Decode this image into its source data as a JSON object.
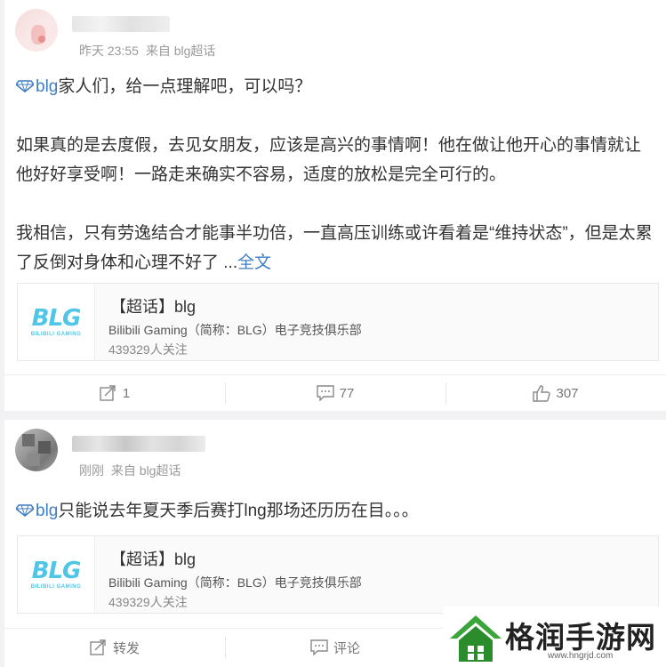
{
  "post1": {
    "meta_time": "昨天 23:55",
    "meta_source": "来自 blg超话",
    "topic_tag": "blg",
    "lead": "家人们，给一点理解吧，可以吗？",
    "para1": "如果真的是去度假，去见女朋友，应该是高兴的事情啊！他在做让他开心的事情就让他好好享受啊！一路走来确实不容易，适度的放松是完全可行的。",
    "para2": "我相信，只有劳逸结合才能事半功倍，一直高压训练或许看着是“维持状态”，但是太累了反倒对身体和心理不好了 ",
    "ellipsis": "...",
    "more": "全文",
    "topic_card": {
      "title": "【超话】blg",
      "desc": "Bilibili Gaming（简称：BLG）电子竞技俱乐部",
      "followers": "439329人关注",
      "logo_big": "BLG",
      "logo_small": "BILIBILI GAMING"
    },
    "actions": {
      "repost": "1",
      "comment": "77",
      "like": "307"
    }
  },
  "post2": {
    "meta_time": "刚刚",
    "meta_source": "来自 blg超话",
    "topic_tag": "blg",
    "text": "只能说去年夏天季后赛打lng那场还历历在目。。。",
    "topic_card": {
      "title": "【超话】blg",
      "desc": "Bilibili Gaming（简称：BLG）电子竞技俱乐部",
      "followers": "439329人关注",
      "logo_big": "BLG",
      "logo_small": "BILIBILI GAMING"
    },
    "actions": {
      "repost": "转发",
      "comment": "评论"
    }
  },
  "watermark": {
    "name": "格润手游网",
    "url": "www.hngrjd.com"
  },
  "colors": {
    "link": "#3f7ec2",
    "logo": "#4fc6e6",
    "watermark_green": "#3aa63a"
  }
}
